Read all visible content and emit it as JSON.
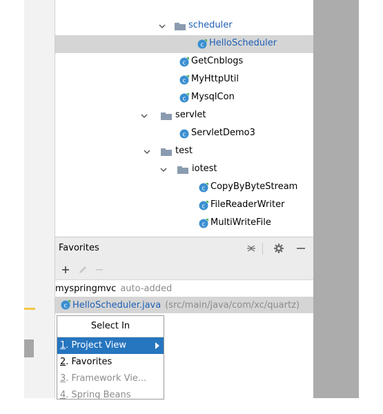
{
  "colors": {
    "accent": "#2675bf",
    "class_icon": "#3a8fd1",
    "folder": "#8a9bb0"
  },
  "tree": [
    {
      "label": "scheduler",
      "type": "folder",
      "expanded": true,
      "label_color": "blue"
    },
    {
      "label": "HelloScheduler",
      "type": "class",
      "selected": true,
      "label_color": "blue"
    },
    {
      "label": "GetCnblogs",
      "type": "class"
    },
    {
      "label": "MyHttpUtil",
      "type": "class"
    },
    {
      "label": "MysqlCon",
      "type": "class"
    },
    {
      "label": "servlet",
      "type": "folder",
      "expanded": true
    },
    {
      "label": "ServletDemo3",
      "type": "class"
    },
    {
      "label": "test",
      "type": "folder",
      "expanded": true
    },
    {
      "label": "iotest",
      "type": "folder",
      "expanded": true
    },
    {
      "label": "CopyByByteStream",
      "type": "class"
    },
    {
      "label": "FileReaderWriter",
      "type": "class"
    },
    {
      "label": "MultiWriteFile",
      "type": "class"
    }
  ],
  "favorites": {
    "title": "Favorites",
    "list_name": "myspringmvc",
    "list_note": "auto-added",
    "entry_file": "HelloScheduler.java",
    "entry_path": "(src/main/java/com/xc/quartz)",
    "icons": [
      "add-icon",
      "edit-icon",
      "remove-icon",
      "collapse-icon",
      "gear-icon",
      "minimize-icon"
    ]
  },
  "popup": {
    "title": "Select In",
    "items": [
      {
        "num": "1",
        "label": ". Project View"
      },
      {
        "num": "2",
        "label": ". Favorites"
      },
      {
        "num": "3",
        "label": ". Framework Vie..."
      },
      {
        "num": "4",
        "label": ". Spring Beans"
      }
    ]
  }
}
